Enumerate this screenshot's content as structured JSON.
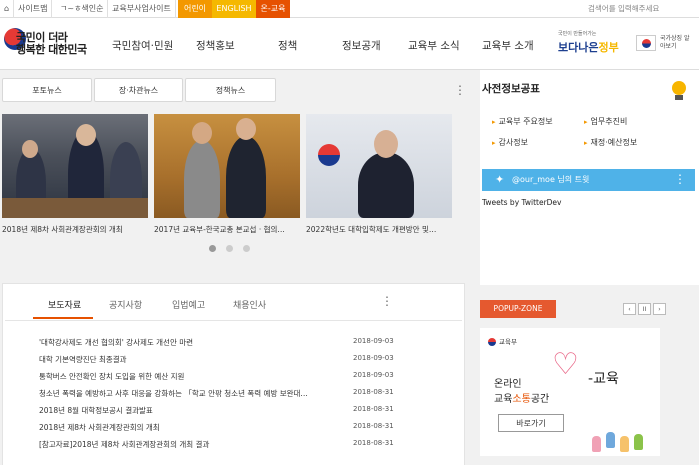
{
  "topbar": {
    "links": [
      "사이트맵",
      "ㄱ~ㅎ색인순",
      "교육부사업사이트",
      "어린이",
      "ENGLISH",
      "온-교육"
    ],
    "search_placeholder": "검색어를 입력해주세요"
  },
  "header": {
    "logo_text_1": "국민이 더라",
    "logo_text_2": "행복한 대한민국",
    "nav": [
      "국민참여·민원",
      "정책홍보",
      "정책",
      "정보공개",
      "교육부 소식",
      "교육부 소개"
    ],
    "better_gov_small": "국민이 만들어가는",
    "better_gov_main": "보다나은",
    "better_gov_accent": "정부",
    "gov_symbol_label": "국가상징 알아보기"
  },
  "news": {
    "tabs": [
      "포토뉴스",
      "장·차관뉴스",
      "정책뉴스"
    ],
    "cards": [
      {
        "caption": "2018년 제8차 사회관계장관회의 개최"
      },
      {
        "caption": "2017년 교육부-한국교총 본교섭 · 협의…"
      },
      {
        "caption": "2022학년도 대학입학제도 개편방안 및…"
      }
    ]
  },
  "prepublish": {
    "title": "사전정보공표",
    "links": [
      "교육부 주요정보",
      "업무추진비",
      "감사정보",
      "재정·예산정보"
    ]
  },
  "twitter": {
    "handle": "@our_moe 님의 트윗",
    "by": "Tweets by TwitterDev"
  },
  "board": {
    "tabs": [
      "보도자료",
      "공지사항",
      "입법예고",
      "채용인사"
    ],
    "rows": [
      {
        "title": "'대학강사제도 개선 협의회' 강사제도 개선안 마련",
        "date": "2018-09-03"
      },
      {
        "title": "대학 기본역량진단 최종결과",
        "date": "2018-09-03"
      },
      {
        "title": "통학버스 안전확인 장치 도입을 위한 예산 지원",
        "date": "2018-09-03"
      },
      {
        "title": "청소년 폭력을 예방하고 사후 대응을 강화하는 「학교 안팎 청소년 폭력 예방 보완대…",
        "date": "2018-08-31"
      },
      {
        "title": "2018년 8월 대학정보공시 결과발표",
        "date": "2018-08-31"
      },
      {
        "title": "2018년 제8차 사회관계장관회의 개최",
        "date": "2018-08-31"
      },
      {
        "title": "[참고자료]2018년 제8차 사회관계장관회의 개최 결과",
        "date": "2018-08-31"
      }
    ]
  },
  "popup": {
    "tag": "POPUP-ZONE",
    "controls": [
      "‹",
      "II",
      "›"
    ],
    "org": "교육부",
    "edu_word": "교육",
    "line1": "온라인",
    "line2_prefix": "교육",
    "line2_accent": "소통",
    "line2_suffix": "공간",
    "button": "바로가기"
  },
  "colors": {
    "accent_orange": "#e65100",
    "twitter_blue": "#4fb2e8",
    "popup_tag": "#e5592f"
  }
}
